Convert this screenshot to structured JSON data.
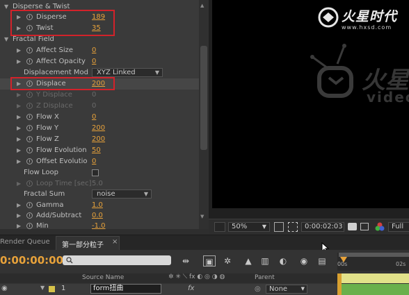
{
  "effect_controls": {
    "disperse_twist_header": "Disperse & Twist",
    "disperse": {
      "label": "Disperse",
      "value": "189"
    },
    "twist": {
      "label": "Twist",
      "value": "35"
    },
    "fractal_field_header": "Fractal Field",
    "affect_size": {
      "label": "Affect Size",
      "value": "0"
    },
    "affect_opacity": {
      "label": "Affect Opacity",
      "value": "0"
    },
    "displacement_mode": {
      "label": "Displacement Mod",
      "value": "XYZ Linked"
    },
    "displace": {
      "label": "Displace",
      "value": "200"
    },
    "y_displace": {
      "label": "Y Displace",
      "value": "0"
    },
    "z_displace": {
      "label": "Z Displace",
      "value": "0"
    },
    "flow_x": {
      "label": "Flow X",
      "value": "0"
    },
    "flow_y": {
      "label": "Flow Y",
      "value": "200"
    },
    "flow_z": {
      "label": "Flow Z",
      "value": "200"
    },
    "flow_evolution": {
      "label": "Flow Evolution",
      "value": "50"
    },
    "offset_evolution": {
      "label": "Offset Evolutio",
      "value": "0"
    },
    "flow_loop": {
      "label": "Flow Loop",
      "checked": false
    },
    "loop_time": {
      "label": "Loop Time [sec]",
      "value": "5.0"
    },
    "fractal_sum": {
      "label": "Fractal Sum",
      "value": "noise"
    },
    "gamma": {
      "label": "Gamma",
      "value": "1.0"
    },
    "add_subtract": {
      "label": "Add/Subtract",
      "value": "0.0"
    },
    "min": {
      "label": "Min",
      "value": "-1.0"
    }
  },
  "viewer": {
    "watermark_top_brand": "火星时代",
    "watermark_top_url": "www.hxsd.com",
    "watermark_center_brand": "火星",
    "watermark_center_sub": "video.h",
    "zoom": "50%",
    "timecode": "0:00:02:03",
    "resolution": "Full"
  },
  "timeline": {
    "tab_render_queue": "Render Queue",
    "tab_comp": "第一部分粒子",
    "tab_close": "×",
    "current_time": "0:00:00:00",
    "search_placeholder": "",
    "col_source_name": "Source Name",
    "col_parent": "Parent",
    "layer_number": "1",
    "layer_name": "form扭曲",
    "layer_parent": "None",
    "ruler_start": "00s",
    "ruler_end": "02s"
  },
  "colors": {
    "value_orange": "#e8a23a",
    "highlight_red": "#d3222a",
    "work_area_yellow": "#e2e28a",
    "layer_bar_green": "#6ab04c"
  }
}
